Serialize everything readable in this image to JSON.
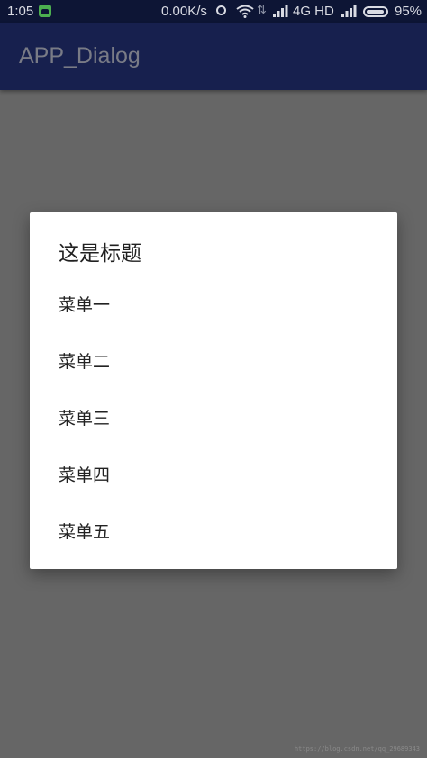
{
  "status_bar": {
    "time": "1:05",
    "speed": "0.00K/s",
    "network": "4G HD",
    "battery": "95%",
    "battery_level": 0.95
  },
  "app_bar": {
    "title": "APP_Dialog"
  },
  "dialog": {
    "title": "这是标题",
    "items": [
      {
        "label": "菜单一"
      },
      {
        "label": "菜单二"
      },
      {
        "label": "菜单三"
      },
      {
        "label": "菜单四"
      },
      {
        "label": "菜单五"
      }
    ]
  },
  "watermark": "https://blog.csdn.net/qq_29689343",
  "colors": {
    "status_bar_bg": "#0d1535",
    "app_bar_bg": "#17204e",
    "scrim": "#666666",
    "dialog_bg": "#ffffff"
  }
}
